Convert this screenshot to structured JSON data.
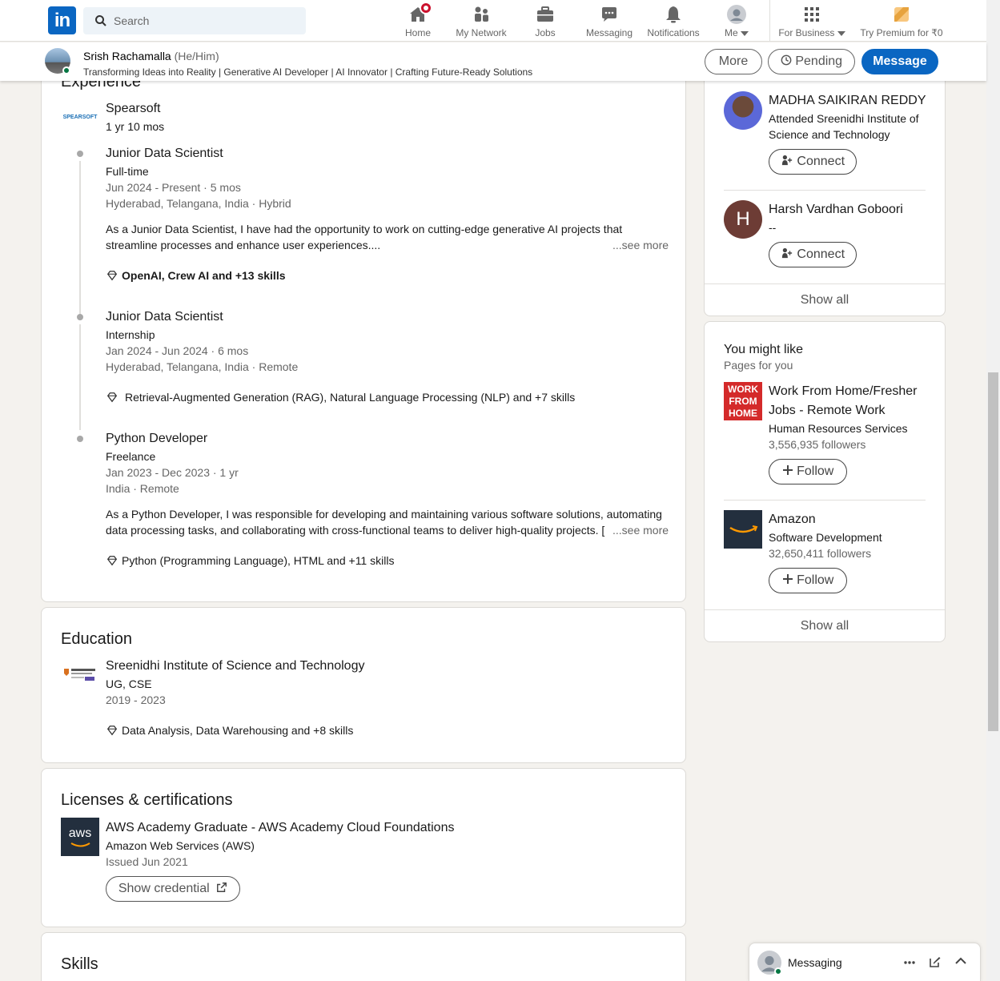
{
  "nav": {
    "search_placeholder": "Search",
    "items": [
      {
        "label": "Home",
        "icon": "home-icon"
      },
      {
        "label": "My Network",
        "icon": "network-icon"
      },
      {
        "label": "Jobs",
        "icon": "briefcase-icon"
      },
      {
        "label": "Messaging",
        "icon": "chat-icon"
      },
      {
        "label": "Notifications",
        "icon": "bell-icon"
      },
      {
        "label": "Me",
        "icon": "avatar-icon"
      },
      {
        "label": "For Business",
        "icon": "grid-icon"
      },
      {
        "label": "Try Premium for ₹0",
        "icon": "premium-icon"
      }
    ],
    "colors": {
      "brand": "#0a66c2",
      "badge": "#cb112d"
    }
  },
  "profile_bar": {
    "name": "Srish Rachamalla",
    "pronouns": "(He/Him)",
    "headline": "Transforming Ideas into Reality | Generative AI Developer | AI Innovator | Crafting Future-Ready Solutions",
    "more": "More",
    "pending": "Pending",
    "message": "Message"
  },
  "experience": {
    "title": "Experience",
    "company": "Spearsoft",
    "company_logo_text": "SPEARSOFT",
    "duration": "1 yr 10 mos",
    "roles": [
      {
        "title": "Junior Data Scientist",
        "type": "Full-time",
        "dates": "Jun 2024 - Present · 5 mos",
        "location": "Hyderabad, Telangana, India · Hybrid",
        "desc1": "As a Junior Data Scientist, I have had the opportunity to work on cutting-edge generative AI projects that",
        "desc2": "streamline processes and enhance user experiences....",
        "see_more": "...see more",
        "skills": "OpenAI, Crew AI and +13 skills"
      },
      {
        "title": "Junior Data Scientist",
        "type": "Internship",
        "dates": "Jan 2024 - Jun 2024 · 6 mos",
        "location": "Hyderabad, Telangana, India · Remote",
        "skills": "Retrieval-Augmented Generation (RAG), Natural Language Processing (NLP) and +7 skills"
      },
      {
        "title": "Python Developer",
        "type": "Freelance",
        "dates": "Jan 2023 - Dec 2023 · 1 yr",
        "location": "India · Remote",
        "desc1": "As a Python Developer, I was responsible for developing and maintaining various software solutions, automating",
        "desc2": "data processing tasks, and collaborating with cross-functional teams to deliver high-quality projects. [",
        "see_more": "...see more",
        "skills": "Python (Programming Language), HTML and +11 skills"
      }
    ]
  },
  "education": {
    "title": "Education",
    "school": "Sreenidhi Institute of Science and Technology",
    "degree": "UG, CSE",
    "years": "2019 - 2023",
    "skills": "Data Analysis, Data Warehousing and +8 skills"
  },
  "licenses": {
    "title": "Licenses & certifications",
    "name": "AWS Academy Graduate - AWS Academy Cloud Foundations",
    "issuer": "Amazon Web Services (AWS)",
    "issued": "Issued Jun 2021",
    "logo_text": "aws",
    "button": "Show credential"
  },
  "skills": {
    "title": "Skills"
  },
  "people": {
    "items": [
      {
        "name": "MADHA SAIKIRAN REDDY",
        "line1": "Attended Sreenidhi Institute of",
        "line2": "Science and Technology",
        "button": "Connect"
      },
      {
        "name": "Harsh Vardhan Goboori",
        "line1": "--",
        "initial": "H",
        "button": "Connect"
      }
    ],
    "show_all": "Show all"
  },
  "might_like": {
    "title": "You might like",
    "subtitle": "Pages for you",
    "items": [
      {
        "name1": "Work From Home/Fresher",
        "name2": "Jobs - Remote Work",
        "industry": "Human Resources Services",
        "followers": "3,556,935 followers",
        "logo_lines": [
          "WORK",
          "FROM",
          "HOME"
        ],
        "button": "Follow"
      },
      {
        "name1": "Amazon",
        "industry": "Software Development",
        "followers": "32,650,411 followers",
        "button": "Follow"
      }
    ],
    "show_all": "Show all"
  },
  "messaging": {
    "label": "Messaging"
  }
}
